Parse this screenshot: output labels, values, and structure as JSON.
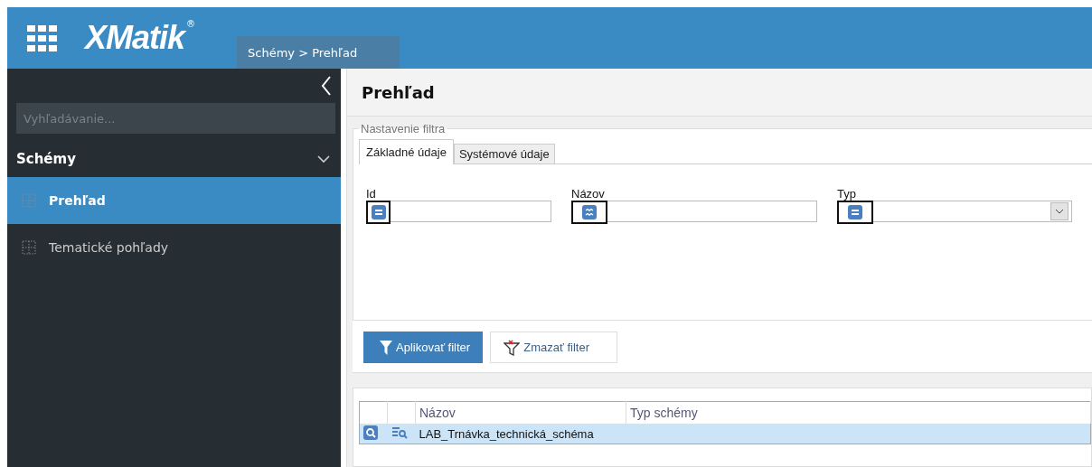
{
  "header": {
    "logo": "XMatik",
    "logo_mark": "®",
    "breadcrumb": "Schémy > Prehľad"
  },
  "sidebar": {
    "search": {
      "placeholder": "Vyhľadávanie..."
    },
    "section": {
      "label": "Schémy",
      "expanded": true
    },
    "items": [
      {
        "label": "Prehľad",
        "selected": true
      },
      {
        "label": "Tematické pohľady",
        "selected": false
      }
    ]
  },
  "page_title": "Prehľad",
  "filter": {
    "legend": "Nastavenie filtra",
    "tabs": [
      {
        "label": "Základné údaje",
        "selected": true
      },
      {
        "label": "Systémové údaje",
        "selected": false
      }
    ],
    "fields": [
      {
        "label": "Id",
        "kind": "text",
        "operator": {
          "kind": "equals"
        }
      },
      {
        "label": "Názov",
        "kind": "text",
        "operator": {
          "kind": "contains"
        }
      },
      {
        "label": "Typ",
        "kind": "select",
        "operator": {
          "kind": "equals"
        }
      }
    ],
    "apply_button": "Aplikovať filter",
    "clear_button": "Zmazať filter"
  },
  "table": {
    "columns": [
      "Názov",
      "Typ schémy"
    ],
    "rows": [
      {
        "cells": [
          "LAB_Trnávka_technická_schéma",
          ""
        ],
        "selected": true
      }
    ]
  }
}
